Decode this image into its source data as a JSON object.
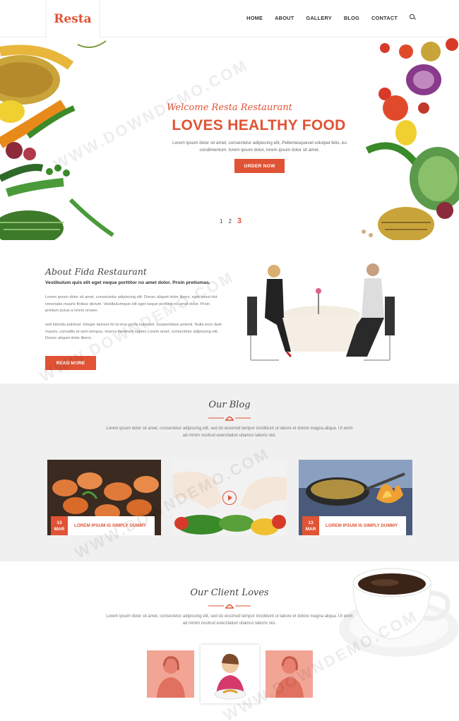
{
  "brand": {
    "logo": "Resta",
    "accent": "#e05334"
  },
  "nav": {
    "items": [
      "HOME",
      "ABOUT",
      "GALLERY",
      "BLOG",
      "CONTACT"
    ],
    "search_icon": "search-icon"
  },
  "hero": {
    "script_title": "Welcome Resta Restaurant",
    "title": "LOVES HEALTHY FOOD",
    "text": "Lorem ipsum dolor sit amet, consectetur adipiscing elit, Pellentesquevel volutpat felis, eu condimentum. lorem ipsum dolor, lorem ipsum dolor sit amet.",
    "button": "ORDER NOW",
    "pages": [
      "1",
      "2",
      "3"
    ],
    "active_page": "3"
  },
  "about": {
    "title": "About Fida Restaurant",
    "lead": "Vestibulum quis elit eget neque porttitor no amet dolor. Proin pretiumas.",
    "p1": "Lorem ipsum dolor sit amet, consectetur adipiscing elit. Donec aliquet dolor libero, eget loved dot venenatis mauris finibus dictum. Vestibulumquis elit eget neque porttitor no amet dolor. Proin pretium purus a lorem ornare.",
    "p2": "sed lobortis pulvinar. Integer laoreet mi id eros porta euismod. Suspendisse potenti. Nulla eros duet mauris, convallis et sem tempus, viverra hendrerit sapien Lorem amet, consectetur adipiscing elit. Donec aliquet dolor libero.",
    "button": "READ MORE"
  },
  "blog": {
    "title": "Our Blog",
    "desc": "Lorem ipsum dolor sit amet, consectetur adipiscing elit, sed do eiusmod tempor incididunt ut labore et dolore magna aliqua. Ut enim ad minim nostrud exercitation ullamco laboris nisi.",
    "cards": [
      {
        "day": "13",
        "month": "MAR",
        "title": "LOREM IPSUM IS SIMPLY DUMMY"
      },
      {
        "day": "",
        "month": "",
        "title": ""
      },
      {
        "day": "13",
        "month": "MAR",
        "title": "LOREM IPSUM IS SIMPLY DUMMY"
      }
    ]
  },
  "clients": {
    "title": "Our Client Loves",
    "desc": "Lorem ipsum dolor sit amet, consectetur adipiscing elit, sed do eiusmod tempor incididunt ut labore et dolore magna aliqua. Ut enim ad minim nostrud exercitation ullamco laboris nisi."
  },
  "watermark": "WWW.DOWNDEMO.COM"
}
